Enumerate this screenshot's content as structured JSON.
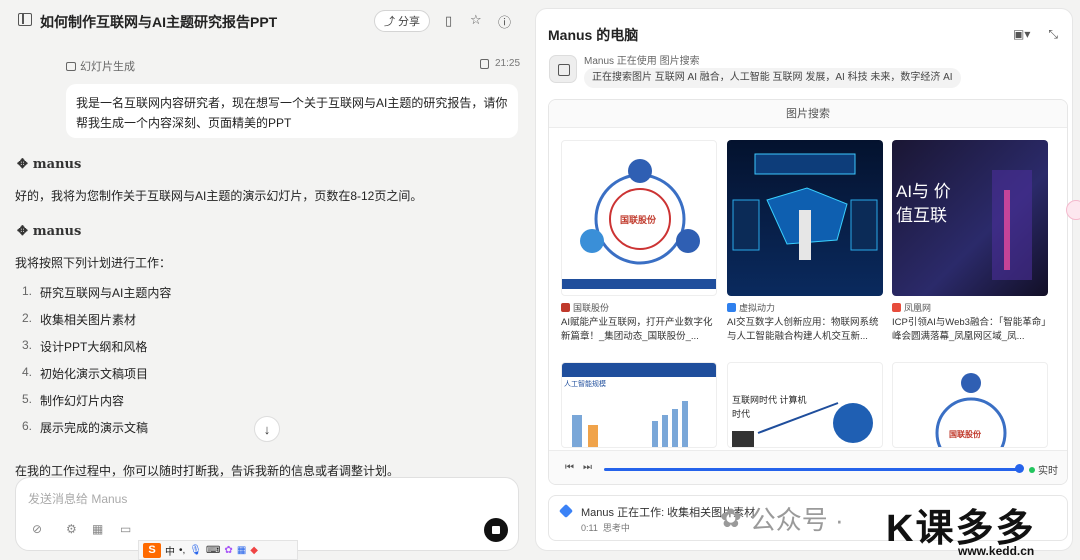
{
  "header": {
    "title": "如何制作互联网与AI主题研究报告PPT",
    "share_label": "分享"
  },
  "chat": {
    "tag_label": "幻灯片生成",
    "timestamp": "21:25",
    "user_message": "我是一名互联网内容研究者，现在想写一个关于互联网与AI主题的研究报告，请你帮我生成一个内容深刻、页面精美的PPT",
    "assistant_name": "manus",
    "reply1": "好的，我将为您制作关于互联网与AI主题的演示幻灯片，页数在8-12页之间。",
    "reply2": "我将按照下列计划进行工作：",
    "steps": [
      {
        "n": "1.",
        "text": "研究互联网与AI主题内容"
      },
      {
        "n": "2.",
        "text": "收集相关图片素材"
      },
      {
        "n": "3.",
        "text": "设计PPT大纲和风格"
      },
      {
        "n": "4.",
        "text": "初始化演示文稿项目"
      },
      {
        "n": "5.",
        "text": "制作幻灯片内容"
      },
      {
        "n": "6.",
        "text": "展示完成的演示文稿"
      }
    ],
    "reply3": "在我的工作过程中，你可以随时打断我，告诉我新的信息或者调整计划。",
    "input_placeholder": "发送消息给 Manus"
  },
  "ime": {
    "mode": "中"
  },
  "computer": {
    "title": "Manus 的电脑",
    "using_text": "Manus 正在使用 图片搜索",
    "query": "正在搜索图片  互联网 AI 融合，人工智能 互联网 发展，AI 科技 未来，数字经济 AI",
    "browser_title": "图片搜索",
    "results": [
      {
        "source": "国联股份",
        "caption": "AI赋能产业互联网，打开产业数字化新篇章！_集团动态_国联股份_...",
        "thumb_text": "国联股份",
        "color": "#c0392b"
      },
      {
        "source": "虚拟动力",
        "caption": "AI交互数字人创新应用：物联网系统与人工智能融合构建人机交互新...",
        "thumb_text": "",
        "color": "#2f80ed"
      },
      {
        "source": "凤凰网",
        "caption": "ICP引领AI与Web3融合：「智能革命」峰会圆满落幕_凤凰网区域_凤...",
        "thumb_text": "AI与 价值互联",
        "color": "#e74c3c"
      },
      {
        "source": "",
        "caption": "",
        "thumb_text": "人工智能规模",
        "color": "#1f4e9c"
      },
      {
        "source": "",
        "caption": "",
        "thumb_text": "互联网时代 计算机时代",
        "color": "#1f4e9c"
      },
      {
        "source": "",
        "caption": "",
        "thumb_text": "国联股份",
        "color": "#c0392b"
      }
    ],
    "live_label": "实时",
    "status_text": "Manus 正在工作: 收集相关图片素材",
    "status_time": "0:11",
    "status_sub": "思考中"
  },
  "watermark": {
    "text": "公众号 · ",
    "logo": "K课多多",
    "url": "www.kedd.cn"
  }
}
